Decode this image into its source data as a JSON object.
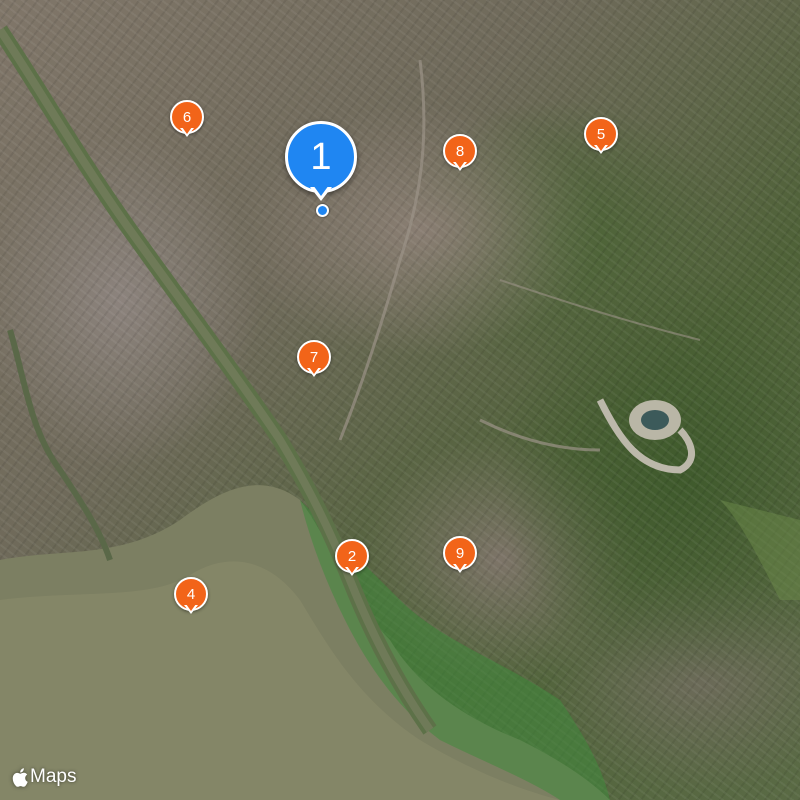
{
  "map": {
    "attribution": "Maps",
    "markers": [
      {
        "label": "1",
        "kind": "selected",
        "color": "#1f86f2"
      },
      {
        "label": "2",
        "kind": "result",
        "color": "#f26419"
      },
      {
        "label": "4",
        "kind": "result",
        "color": "#f26419"
      },
      {
        "label": "5",
        "kind": "result",
        "color": "#f26419"
      },
      {
        "label": "6",
        "kind": "result",
        "color": "#f26419"
      },
      {
        "label": "7",
        "kind": "result",
        "color": "#f26419"
      },
      {
        "label": "8",
        "kind": "result",
        "color": "#f26419"
      },
      {
        "label": "9",
        "kind": "result",
        "color": "#f26419"
      }
    ],
    "logo_icon": "apple-logo-icon"
  }
}
